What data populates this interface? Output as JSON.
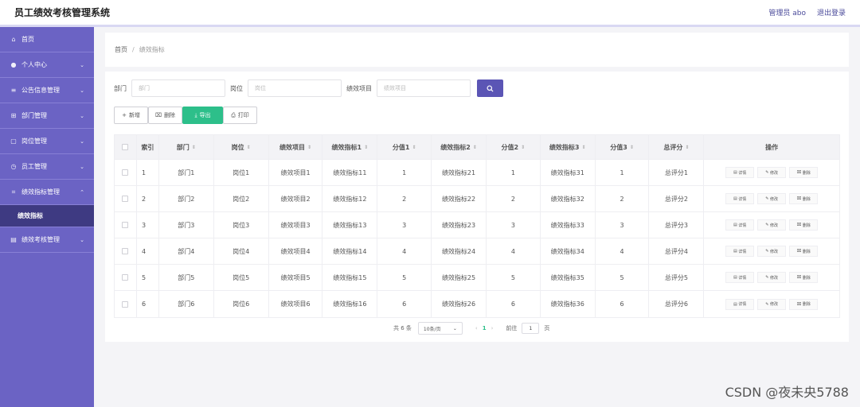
{
  "header": {
    "title": "员工绩效考核管理系统",
    "user_label": "管理员 abo",
    "logout_label": "退出登录"
  },
  "sidebar": {
    "items": [
      {
        "label": "首页",
        "icon": "home-icon",
        "chevron": ""
      },
      {
        "label": "个人中心",
        "icon": "user-icon",
        "chevron": "⌄"
      },
      {
        "label": "公告信息管理",
        "icon": "notice-icon",
        "chevron": "⌄"
      },
      {
        "label": "部门管理",
        "icon": "department-icon",
        "chevron": "⌄"
      },
      {
        "label": "岗位管理",
        "icon": "position-icon",
        "chevron": "⌄"
      },
      {
        "label": "员工管理",
        "icon": "employee-icon",
        "chevron": "⌄"
      },
      {
        "label": "绩效指标管理",
        "icon": "indicator-icon",
        "chevron": "⌃"
      },
      {
        "label": "绩效指标",
        "icon": "",
        "chevron": ""
      },
      {
        "label": "绩效考核管理",
        "icon": "assessment-icon",
        "chevron": "⌄"
      }
    ]
  },
  "breadcrumb": {
    "home": "首页",
    "separator": "/",
    "current": "绩效指标"
  },
  "search": {
    "dept_label": "部门",
    "dept_placeholder": "部门",
    "post_label": "岗位",
    "post_placeholder": "岗位",
    "project_label": "绩效项目",
    "project_placeholder": "绩效项目",
    "search_icon": "search-icon"
  },
  "actions": {
    "add": "新增",
    "delete": "删除",
    "export": "导出",
    "print": "打印"
  },
  "table": {
    "headers": [
      "索引",
      "部门",
      "岗位",
      "绩效项目",
      "绩效指标1",
      "分值1",
      "绩效指标2",
      "分值2",
      "绩效指标3",
      "分值3",
      "总评分",
      "操作"
    ],
    "rows": [
      [
        "1",
        "部门1",
        "岗位1",
        "绩效项目1",
        "绩效指标11",
        "1",
        "绩效指标21",
        "1",
        "绩效指标31",
        "1",
        "总评分1"
      ],
      [
        "2",
        "部门2",
        "岗位2",
        "绩效项目2",
        "绩效指标12",
        "2",
        "绩效指标22",
        "2",
        "绩效指标32",
        "2",
        "总评分2"
      ],
      [
        "3",
        "部门3",
        "岗位3",
        "绩效项目3",
        "绩效指标13",
        "3",
        "绩效指标23",
        "3",
        "绩效指标33",
        "3",
        "总评分3"
      ],
      [
        "4",
        "部门4",
        "岗位4",
        "绩效项目4",
        "绩效指标14",
        "4",
        "绩效指标24",
        "4",
        "绩效指标34",
        "4",
        "总评分4"
      ],
      [
        "5",
        "部门5",
        "岗位5",
        "绩效项目5",
        "绩效指标15",
        "5",
        "绩效指标25",
        "5",
        "绩效指标35",
        "5",
        "总评分5"
      ],
      [
        "6",
        "部门6",
        "岗位6",
        "绩效项目6",
        "绩效指标16",
        "6",
        "绩效指标26",
        "6",
        "绩效指标36",
        "6",
        "总评分6"
      ]
    ],
    "row_ops": {
      "detail": "详情",
      "edit": "修改",
      "delete": "删除"
    }
  },
  "pagination": {
    "total": "共 6 条",
    "page_size": "10条/页",
    "prev": "‹",
    "current_page": "1",
    "next": "›",
    "goto_label": "前往",
    "goto_value": "1",
    "page_suffix": "页"
  },
  "watermark": "CSDN @夜未央5788",
  "colors": {
    "sidebar": "#6b63c4",
    "active_sub": "#3e3a82",
    "primary": "#5b55b5",
    "export_green": "#2dbf8a"
  }
}
